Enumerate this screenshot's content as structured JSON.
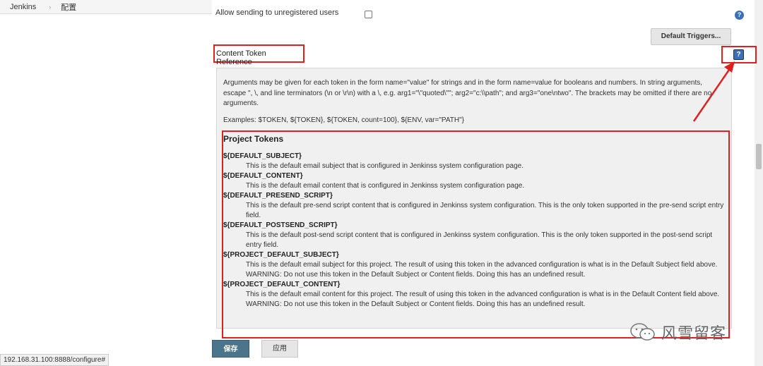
{
  "breadcrumb": {
    "items": [
      "Jenkins",
      "配置"
    ],
    "separator": "›"
  },
  "unregistered_row": {
    "label": "Allow sending to unregistered users",
    "checked": false
  },
  "default_triggers_button": "Default Triggers...",
  "content_token_reference": {
    "label": "Content Token Reference"
  },
  "help": {
    "intro": "Arguments may be given for each token in the form name=\"value\" for strings and in the form name=value for booleans and numbers. In string arguments, escape \", \\, and line terminators (\\n or \\r\\n) with a \\, e.g. arg1=\"\\\"quoted\\\"\"; arg2=\"c:\\\\path\"; and arg3=\"one\\ntwo\". The brackets may be omitted if there are no arguments.",
    "examples": "Examples: $TOKEN, ${TOKEN}, ${TOKEN, count=100}, ${ENV, var=\"PATH\"}",
    "tokens_heading": "Project Tokens",
    "tokens": [
      {
        "name": "${DEFAULT_SUBJECT}",
        "desc": "This is the default email subject that is configured in Jenkinss system configuration page."
      },
      {
        "name": "${DEFAULT_CONTENT}",
        "desc": "This is the default email content that is configured in Jenkinss system configuration page."
      },
      {
        "name": "${DEFAULT_PRESEND_SCRIPT}",
        "desc": "This is the default pre-send script content that is configured in Jenkinss system configuration. This is the only token supported in the pre-send script entry field."
      },
      {
        "name": "${DEFAULT_POSTSEND_SCRIPT}",
        "desc": "This is the default post-send script content that is configured in Jenkinss system configuration. This is the only token supported in the post-send script entry field."
      },
      {
        "name": "${PROJECT_DEFAULT_SUBJECT}",
        "desc": "This is the default email subject for this project. The result of using this token in the advanced configuration is what is in the Default Subject field above. WARNING: Do not use this token in the Default Subject or Content fields. Doing this has an undefined result."
      },
      {
        "name": "${PROJECT_DEFAULT_CONTENT}",
        "desc": "This is the default email content for this project. The result of using this token in the advanced configuration is what is in the Default Content field above. WARNING: Do not use this token in the Default Subject or Content fields. Doing this has an undefined result."
      }
    ]
  },
  "actions": {
    "save": "保存",
    "apply": "应用"
  },
  "status_url": "192.168.31.100:8888/configure#",
  "watermark": {
    "text": "风雪留客",
    "icon": "wechat-icon"
  },
  "colors": {
    "annotation_red": "#e02020",
    "save_button": "#4b758b",
    "help_blue": "#3b6fb6"
  },
  "icons": {
    "help": "question-mark-icon",
    "breadcrumb_separator": "chevron-right-icon"
  }
}
